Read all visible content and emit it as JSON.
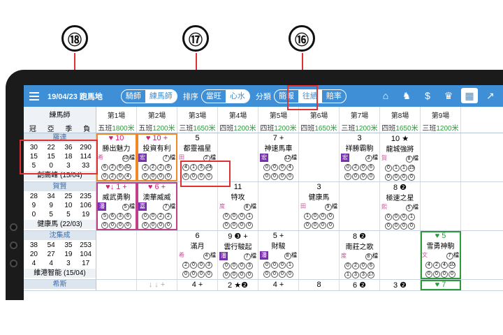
{
  "callouts": [
    "⑱",
    "⑰",
    "⑯"
  ],
  "app": {
    "date_venue": "19/04/23 跑馬地",
    "seg_people": [
      "騎師",
      "練馬師"
    ],
    "sort_label": "排序",
    "seg_sort": [
      "當旺",
      "心水"
    ],
    "cat_label": "分類",
    "seg_cat": [
      "簡報",
      "往績",
      "賠率"
    ]
  },
  "grid": {
    "first_header": "練馬師",
    "first_cols": [
      "冠",
      "亞",
      "季",
      "負"
    ],
    "races": [
      {
        "d": "第1場",
        "c": "五班",
        "m": "1800米"
      },
      {
        "d": "第2場",
        "c": "五班",
        "m": "1200米"
      },
      {
        "d": "第3場",
        "c": "三班",
        "m": "1650米"
      },
      {
        "d": "第4場",
        "c": "四班",
        "m": "1200米"
      },
      {
        "d": "第5場",
        "c": "四班",
        "m": "1200米"
      },
      {
        "d": "第6場",
        "c": "四班",
        "m": "1650米"
      },
      {
        "d": "第7場",
        "c": "三班",
        "m": "1200米"
      },
      {
        "d": "第8場",
        "c": "四班",
        "m": "1650米"
      },
      {
        "d": "第9場",
        "c": "三班",
        "m": "1200米"
      }
    ],
    "trainers": [
      {
        "name": "羅達",
        "stats": [
          "30",
          "22",
          "36",
          "290",
          "15",
          "15",
          "18",
          "114",
          "5",
          "0",
          "3",
          "33"
        ],
        "footer": "創高峰 (15/04)"
      },
      {
        "name": "賀賢",
        "stats": [
          "28",
          "34",
          "25",
          "235",
          "9",
          "9",
          "10",
          "106",
          "0",
          "5",
          "5",
          "19"
        ],
        "footer": "健康馬 (22/03)"
      },
      {
        "name": "沈集成",
        "stats": [
          "38",
          "54",
          "35",
          "253",
          "20",
          "27",
          "19",
          "104",
          "4",
          "4",
          "3",
          "17"
        ],
        "footer": "維港智能 (15/04)"
      },
      {
        "name": "希斯"
      }
    ],
    "row1": [
      {
        "top": "♥ 10",
        "name": "勝出魅力",
        "tag": "希",
        "n": "10",
        "d": "檔",
        "c1": [
          "6",
          "2",
          "6",
          "32"
        ],
        "c2": [
          "0",
          "2",
          "0",
          "4"
        ]
      },
      {
        "top": "♥ 10 +",
        "name": "投資有利",
        "tag": "宏",
        "n": "7",
        "d": "檔",
        "c1": [
          "2",
          "2",
          "2",
          "8"
        ],
        "c2": [
          "0",
          "0",
          "0",
          "0"
        ]
      },
      {
        "top": "5",
        "name": "都靈福星",
        "tag": "田",
        "n": "2",
        "d": "檔",
        "c1": [
          "4",
          "1",
          "3",
          "24"
        ],
        "c2": [
          "0",
          "0",
          "0",
          "0"
        ]
      },
      {
        "top": "",
        "name": "",
        "tag": "",
        "n": "",
        "d": "",
        "c1": [],
        "c2": []
      },
      {
        "top": "7 +",
        "name": "神速馬車",
        "tag": "宏",
        "n": "12",
        "d": "檔",
        "c1": [
          "0",
          "0",
          "0",
          "4"
        ],
        "c2": [
          "0",
          "0",
          "0",
          "0"
        ]
      },
      {
        "top": "",
        "name": "",
        "tag": "",
        "n": "",
        "d": "",
        "c1": [],
        "c2": []
      },
      {
        "top": "3",
        "name": "祥勝霸駒",
        "tag": "宏",
        "n": "3",
        "d": "檔",
        "c1": [
          "0",
          "2",
          "0",
          "6"
        ],
        "c2": [
          "0",
          "0",
          "0",
          "0"
        ]
      },
      {
        "top": "10 ★",
        "name": "龍城強將",
        "tag": "賀",
        "n": "8",
        "d": "檔",
        "c1": [
          "0",
          "1",
          "1",
          "15"
        ],
        "c2": [
          "0",
          "0",
          "0",
          "0"
        ]
      },
      {
        "top": "",
        "name": "",
        "tag": "",
        "n": "",
        "d": "",
        "c1": [],
        "c2": []
      }
    ],
    "row2": [
      {
        "top": "♥↓ 1 +",
        "name": "威武勇駒",
        "tag": "潘",
        "n": "5",
        "d": "檔",
        "c1": [
          "5",
          "6",
          "3",
          "6"
        ],
        "c2": [
          "0",
          "0",
          "0",
          "0"
        ]
      },
      {
        "top": "♥ 6 +",
        "name": "澳華威威",
        "tag": "嘉",
        "n": "7",
        "d": "檔",
        "c1": [
          "0",
          "0",
          "2",
          "2"
        ],
        "c2": [
          "0",
          "0",
          "0",
          "0"
        ]
      },
      {
        "top": "",
        "name": "",
        "tag": "",
        "n": "",
        "d": "",
        "c1": [],
        "c2": []
      },
      {
        "top": "11",
        "name": "特攻",
        "tag": "度",
        "n": "8",
        "d": "檔",
        "c1": [
          "0",
          "0",
          "0",
          "1"
        ],
        "c2": [
          "0",
          "0",
          "0",
          "0"
        ]
      },
      {
        "top": "",
        "name": "",
        "tag": "",
        "n": "",
        "d": "",
        "c1": [],
        "c2": []
      },
      {
        "top": "3",
        "name": "健康馬",
        "tag": "田",
        "n": "9",
        "d": "檔",
        "c1": [
          "1",
          "0",
          "0",
          "0"
        ],
        "c2": [
          "0",
          "0",
          "0",
          "0"
        ]
      },
      {
        "top": "",
        "name": "",
        "tag": "",
        "n": "",
        "d": "",
        "c1": [],
        "c2": []
      },
      {
        "top": "8 ❷",
        "name": "極速之星",
        "tag": "熙",
        "n": "5",
        "d": "檔",
        "c1": [
          "0",
          "0",
          "0",
          "1"
        ],
        "c2": [
          "0",
          "0",
          "0",
          "0"
        ]
      },
      {
        "top": "",
        "name": "",
        "tag": "",
        "n": "",
        "d": "",
        "c1": [],
        "c2": []
      }
    ],
    "row3": [
      {
        "top": "",
        "name": "",
        "tag": "",
        "n": "",
        "d": "",
        "c1": [],
        "c2": []
      },
      {
        "top": "",
        "name": "",
        "tag": "",
        "n": "",
        "d": "",
        "c1": [],
        "c2": []
      },
      {
        "top": "6",
        "name": "滿月",
        "tag": "希",
        "n": "4",
        "d": "檔",
        "c1": [
          "2",
          "0",
          "0",
          "3"
        ],
        "c2": [
          "0",
          "0",
          "0",
          "0"
        ]
      },
      {
        "top": "9 ❸ +",
        "name": "雲行駿起",
        "tag": "潘",
        "n": "7",
        "d": "檔",
        "c1": [
          "0",
          "0",
          "0",
          "3"
        ],
        "c2": [
          "0",
          "0",
          "0",
          "0"
        ]
      },
      {
        "top": "5 +",
        "name": "財駿",
        "tag": "潘",
        "n": "8",
        "d": "檔",
        "c1": [
          "0",
          "0",
          "0",
          "1"
        ],
        "c2": [
          "0",
          "0",
          "0",
          "0"
        ]
      },
      {
        "top": "",
        "name": "",
        "tag": "",
        "n": "",
        "d": "",
        "c1": [],
        "c2": []
      },
      {
        "top": "8 ❷",
        "name": "南莊之歌",
        "tag": "度",
        "n": "8",
        "d": "檔",
        "c1": [
          "0",
          "2",
          "0",
          "6"
        ],
        "c2": [
          "1",
          "3",
          "3",
          "17"
        ]
      },
      {
        "top": "",
        "name": "",
        "tag": "",
        "n": "",
        "d": "",
        "c1": [],
        "c2": []
      },
      {
        "top": "♥ 5",
        "name": "雪勇神駒",
        "tag": "文",
        "n": "7",
        "d": "檔",
        "c1": [
          "4",
          "2",
          "4",
          "10"
        ],
        "c2": [
          "0",
          "0",
          "0",
          "0"
        ]
      }
    ],
    "row4": [
      "",
      "↓ ↓ +",
      "4 +",
      "2 ★❷",
      "4 +",
      "8",
      "6 ❷",
      "3 ❷",
      "♥ 7"
    ]
  }
}
